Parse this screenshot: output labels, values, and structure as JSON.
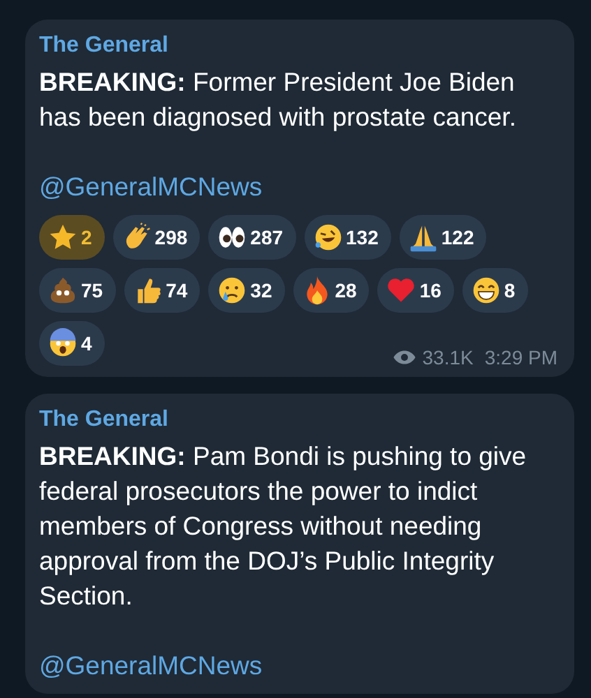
{
  "messages": [
    {
      "channel": "The General",
      "text": "**BREAKING:** Former President Joe Biden has been diagnosed with prostate cancer.",
      "link": "@GeneralMCNews",
      "reactions": [
        {
          "kind": "star",
          "count": "2",
          "selected": true
        },
        {
          "kind": "clap",
          "count": "298",
          "selected": false
        },
        {
          "kind": "eyes",
          "count": "287",
          "selected": false
        },
        {
          "kind": "rofl",
          "count": "132",
          "selected": false
        },
        {
          "kind": "pray",
          "count": "122",
          "selected": false
        },
        {
          "kind": "poop",
          "count": "75",
          "selected": false
        },
        {
          "kind": "thumbs",
          "count": "74",
          "selected": false
        },
        {
          "kind": "cry",
          "count": "32",
          "selected": false
        },
        {
          "kind": "fire",
          "count": "28",
          "selected": false
        },
        {
          "kind": "heart",
          "count": "16",
          "selected": false
        },
        {
          "kind": "grin",
          "count": "8",
          "selected": false
        },
        {
          "kind": "scream",
          "count": "4",
          "selected": false
        }
      ],
      "views": "33.1K",
      "time": "3:29 PM"
    },
    {
      "channel": "The General",
      "text": "**BREAKING:** Pam Bondi is pushing to give federal prosecutors the power to indict members of Congress without needing approval from the DOJ’s Public Integrity Section.",
      "link": "@GeneralMCNews"
    }
  ]
}
